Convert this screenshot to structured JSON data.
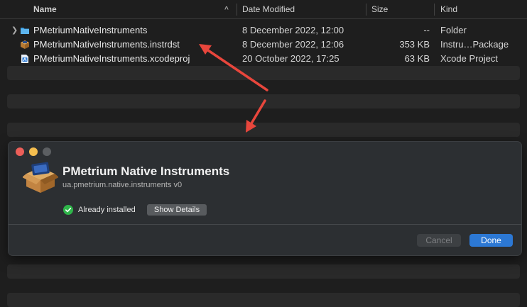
{
  "finder": {
    "columns": {
      "name": "Name",
      "date": "Date Modified",
      "size": "Size",
      "kind": "Kind"
    },
    "rows": [
      {
        "name": "PMetriumNativeInstruments",
        "date": "8 December 2022, 12:00",
        "size": "--",
        "kind": "Folder",
        "icon": "folder-icon"
      },
      {
        "name": "PMetriumNativeInstruments.instrdst",
        "date": "8 December 2022, 12:06",
        "size": "353 KB",
        "kind": "Instru…Package",
        "icon": "package-icon"
      },
      {
        "name": "PMetriumNativeInstruments.xcodeproj",
        "date": "20 October 2022, 17:25",
        "size": "63 KB",
        "kind": "Xcode Project",
        "icon": "xcodeproj-icon"
      }
    ]
  },
  "dialog": {
    "title": "PMetrium Native Instruments",
    "subtitle": "ua.pmetrium.native.instruments v0",
    "status": "Already installed",
    "show_details": "Show Details",
    "cancel": "Cancel",
    "done": "Done"
  },
  "colors": {
    "accent": "#2c78d4",
    "arrow": "#e8463c",
    "success": "#2fb54a"
  }
}
